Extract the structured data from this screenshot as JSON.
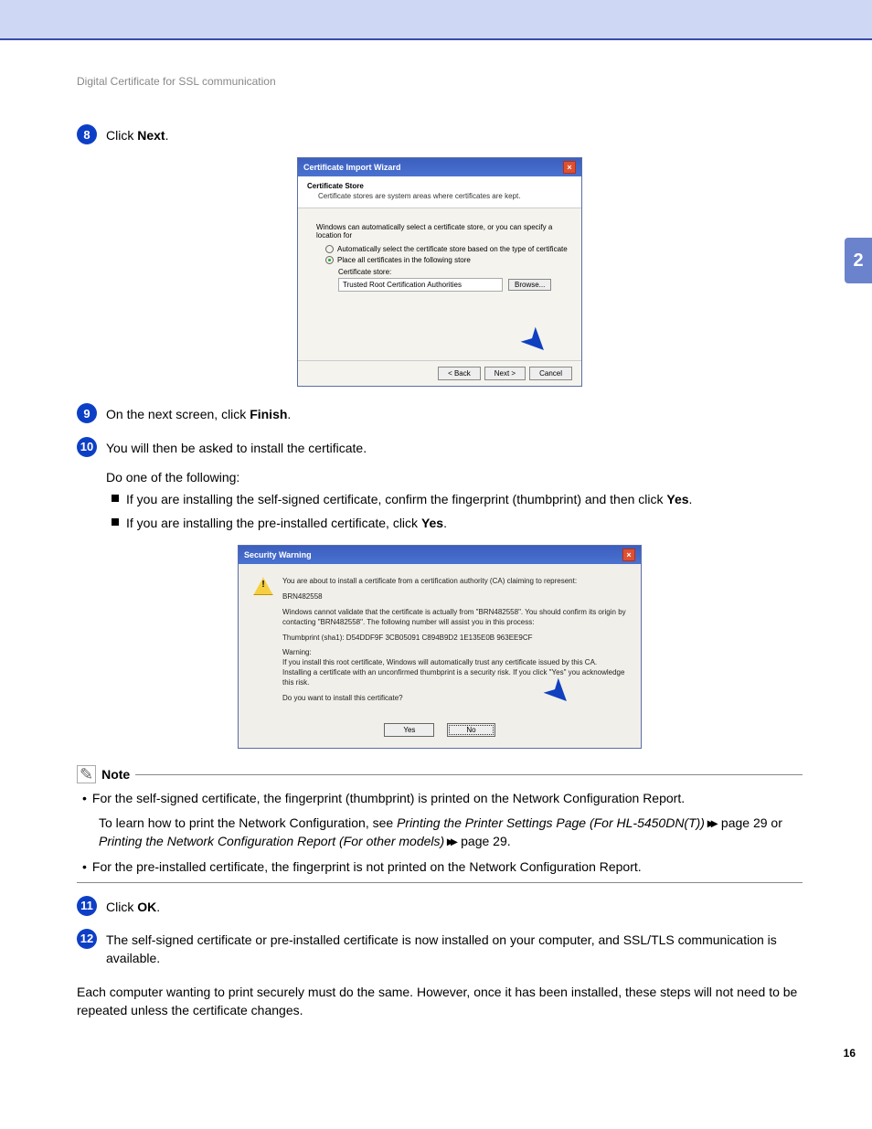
{
  "header_title": "Digital Certificate for SSL communication",
  "side_tab": "2",
  "page_number": "16",
  "steps": {
    "s8": {
      "num": "8",
      "text_pre": "Click ",
      "text_bold": "Next",
      "text_post": "."
    },
    "s9": {
      "num": "9",
      "text_pre": "On the next screen, click ",
      "text_bold": "Finish",
      "text_post": "."
    },
    "s10": {
      "num": "10",
      "line1": "You will then be asked to install the certificate.",
      "line2": "Do one of the following:",
      "bullet1_pre": "If you are installing the self-signed certificate, confirm the  fingerprint (thumbprint)  and then click ",
      "bullet1_bold": "Yes",
      "bullet1_post": ".",
      "bullet2_pre": "If you are installing the pre-installed certificate, click ",
      "bullet2_bold": "Yes",
      "bullet2_post": "."
    },
    "s11": {
      "num": "11",
      "text_pre": "Click ",
      "text_bold": "OK",
      "text_post": "."
    },
    "s12": {
      "num": "12",
      "text": "The self-signed certificate or pre-installed certificate is now installed on your computer, and SSL/TLS communication is available."
    }
  },
  "wizard": {
    "title": "Certificate Import Wizard",
    "head_title": "Certificate Store",
    "head_sub": "Certificate stores are system areas where certificates are kept.",
    "lead": "Windows can automatically select a certificate store, or you can specify a location for",
    "radio_auto": "Automatically select the certificate store based on the type of certificate",
    "radio_place": "Place all certificates in the following store",
    "store_label": "Certificate store:",
    "store_value": "Trusted Root Certification Authorities",
    "browse": "Browse...",
    "back": "< Back",
    "next": "Next >",
    "cancel": "Cancel"
  },
  "secwarn": {
    "title": "Security Warning",
    "p1": "You are about to install a certificate from a certification authority (CA) claiming to represent:",
    "p2": "BRN482558",
    "p3": "Windows cannot validate that the certificate is actually from \"BRN482558\". You should confirm its origin by contacting \"BRN482558\". The following number will assist you in this process:",
    "p4": "Thumbprint (sha1): D54DDF9F 3CB05091 C894B9D2 1E135E0B 963EE9CF",
    "p5a": "Warning:",
    "p5b": "If you install this root certificate, Windows will automatically trust any certificate issued by this CA. Installing a certificate with an unconfirmed thumbprint is a security risk. If you click \"Yes\" you acknowledge this risk.",
    "p6": "Do you want to install this certificate?",
    "yes": "Yes",
    "no": "No"
  },
  "note": {
    "label": "Note",
    "item1": "For the self-signed certificate, the fingerprint (thumbprint) is printed on the Network Configuration Report.",
    "sub_pre": "To learn how to print the Network Configuration, see ",
    "sub_link1": "Printing the Printer Settings Page (For HL-5450DN(T))",
    "sub_mid1": " page 29 or ",
    "sub_link2": "Printing the Network Configuration Report (For other models)",
    "sub_mid2": " page 29.",
    "item2": "For the pre-installed certificate, the fingerprint is not printed on the Network Configuration Report."
  },
  "footer_para": "Each computer wanting to print securely must do the same. However, once it has been installed, these steps will not need to be repeated unless the certificate changes."
}
